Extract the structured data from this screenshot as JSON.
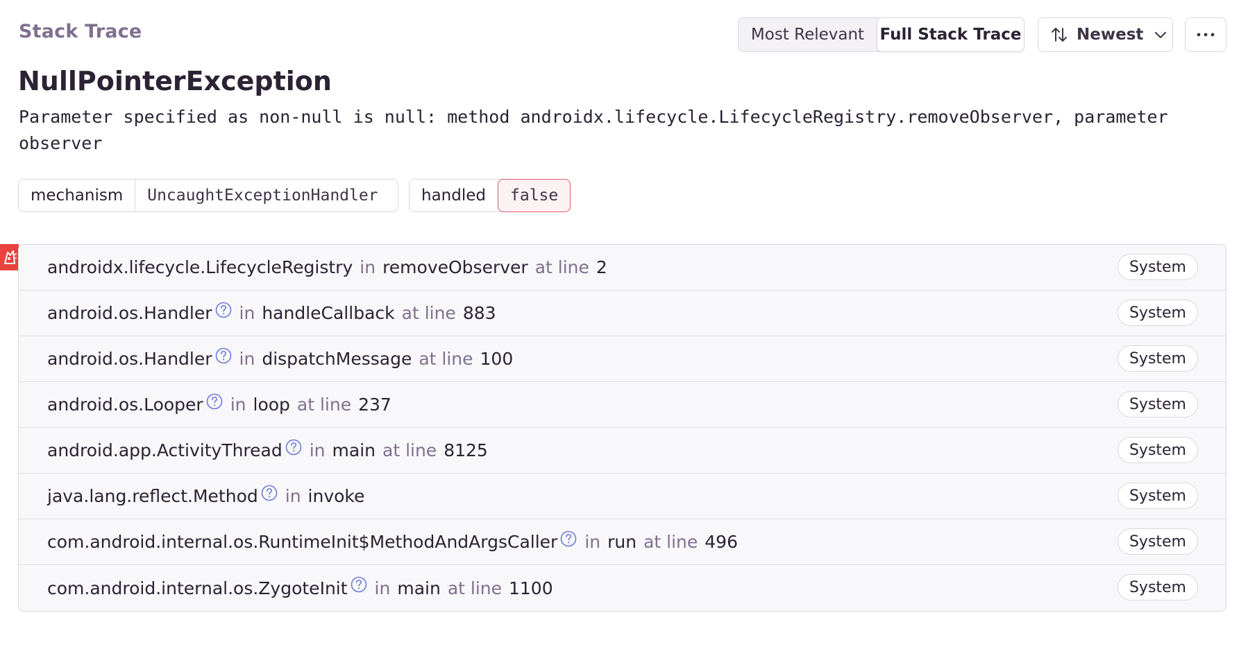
{
  "header": {
    "section_title": "Stack Trace",
    "view_toggle": {
      "most_relevant": "Most Relevant",
      "full_stack_trace": "Full Stack Trace"
    },
    "sort_label": "Newest"
  },
  "exception": {
    "type": "NullPointerException",
    "message": "Parameter specified as non-null is null: method androidx.lifecycle.LifecycleRegistry.removeObserver, parameter observer"
  },
  "tags": [
    {
      "key": "mechanism",
      "value": "UncaughtExceptionHandler"
    },
    {
      "key": "handled",
      "value": "false"
    }
  ],
  "labels": {
    "in": "in",
    "at_line": "at line",
    "badge": "System"
  },
  "frames": [
    {
      "module": "androidx.lifecycle.LifecycleRegistry",
      "function": "removeObserver",
      "line": "2"
    },
    {
      "module": "android.os.Handler",
      "function": "handleCallback",
      "line": "883"
    },
    {
      "module": "android.os.Handler",
      "function": "dispatchMessage",
      "line": "100"
    },
    {
      "module": "android.os.Looper",
      "function": "loop",
      "line": "237"
    },
    {
      "module": "android.app.ActivityThread",
      "function": "main",
      "line": "8125"
    },
    {
      "module": "java.lang.reflect.Method",
      "function": "invoke",
      "line": ""
    },
    {
      "module": "com.android.internal.os.RuntimeInit$MethodAndArgsCaller",
      "function": "run",
      "line": "496"
    },
    {
      "module": "com.android.internal.os.ZygoteInit",
      "function": "main",
      "line": "1100"
    }
  ],
  "colors": {
    "accent_red": "#e8433c",
    "help_icon": "#6c7ad9",
    "muted": "#80708f"
  }
}
